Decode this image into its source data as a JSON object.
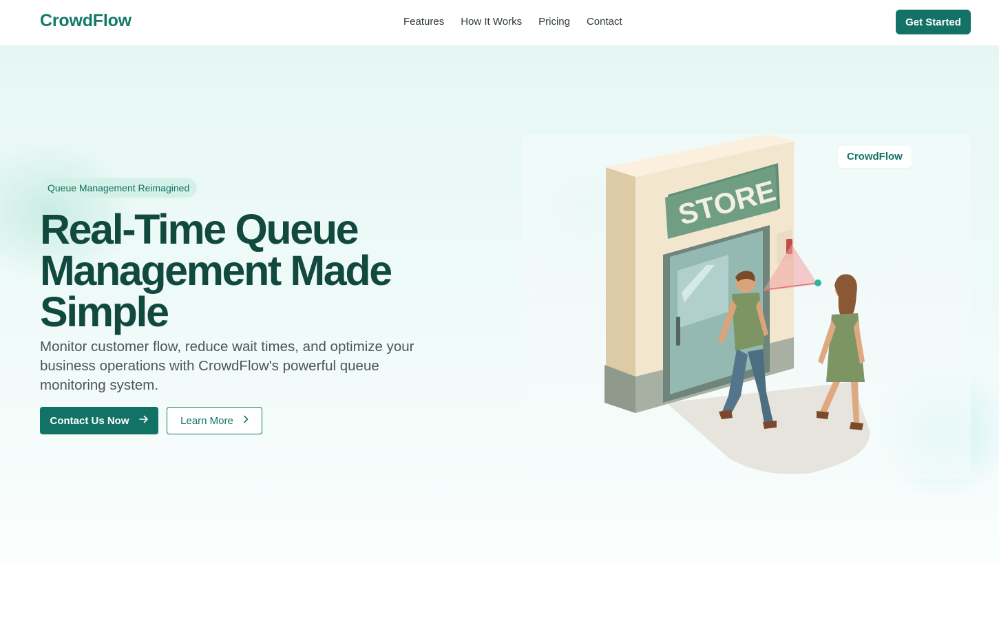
{
  "header": {
    "logo": "CrowdFlow",
    "nav": [
      "Features",
      "How It Works",
      "Pricing",
      "Contact"
    ],
    "cta_label": "Get Started"
  },
  "hero": {
    "badge": "Queue Management Reimagined",
    "headline_lines": [
      "Real-Time Queue",
      "Management Made",
      "Simple"
    ],
    "subtext": "Monitor customer flow, reduce wait times, and optimize your business operations with CrowdFlow's powerful queue monitoring system.",
    "primary_button": "Contact Us Now",
    "secondary_button": "Learn More",
    "primary_icon": "arrow-right-icon",
    "secondary_icon": "chevron-right-icon"
  },
  "illustration": {
    "store_sign": "STORE",
    "brand_chip": "CrowdFlow"
  },
  "colors": {
    "brand": "#137266",
    "headline": "#12493f",
    "badge_bg": "#d3f1e7",
    "sign_green": "#6f9e83"
  }
}
